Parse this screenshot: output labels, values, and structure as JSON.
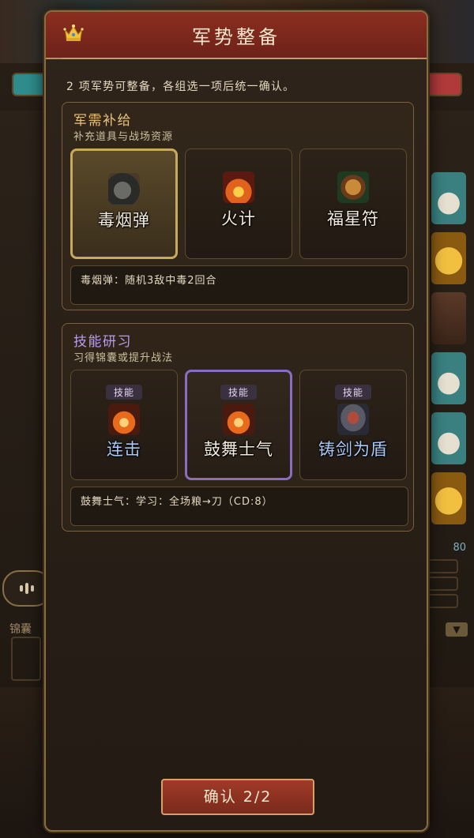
{
  "modal": {
    "title": "军势整备",
    "intro": "2 项军势可整备，各组选一项后统一确认。",
    "confirm_label": "确认 2/2"
  },
  "supply": {
    "title": "军需补给",
    "subtitle": "补充道具与战场资源",
    "options": [
      {
        "label": "毒烟弹",
        "icon": "smoke-bomb-icon",
        "selected": true
      },
      {
        "label": "火计",
        "icon": "fire-stratagem-icon",
        "selected": false
      },
      {
        "label": "福星符",
        "icon": "lucky-charm-icon",
        "selected": false
      }
    ],
    "description": "毒烟弹：随机3敌中毒2回合"
  },
  "skill": {
    "title": "技能研习",
    "subtitle": "习得锦囊或提升战法",
    "options": [
      {
        "tag": "技能",
        "label": "连击",
        "icon": "flame-icon",
        "selected": false
      },
      {
        "tag": "技能",
        "label": "鼓舞士气",
        "icon": "flame-icon",
        "selected": true
      },
      {
        "tag": "技能",
        "label": "铸剑为盾",
        "icon": "armor-icon",
        "selected": false
      }
    ],
    "description": "鼓舞士气：学习：全场粮→刀（CD:8）"
  },
  "background": {
    "left_label": "锦囊",
    "right_value": "80"
  },
  "colors": {
    "header_red": "#7a2a1c",
    "gold_selected": "#c9a95c",
    "purple_selected": "#8c6cc0",
    "skill_title": "#b89cf0",
    "supply_title": "#e8c27a"
  }
}
